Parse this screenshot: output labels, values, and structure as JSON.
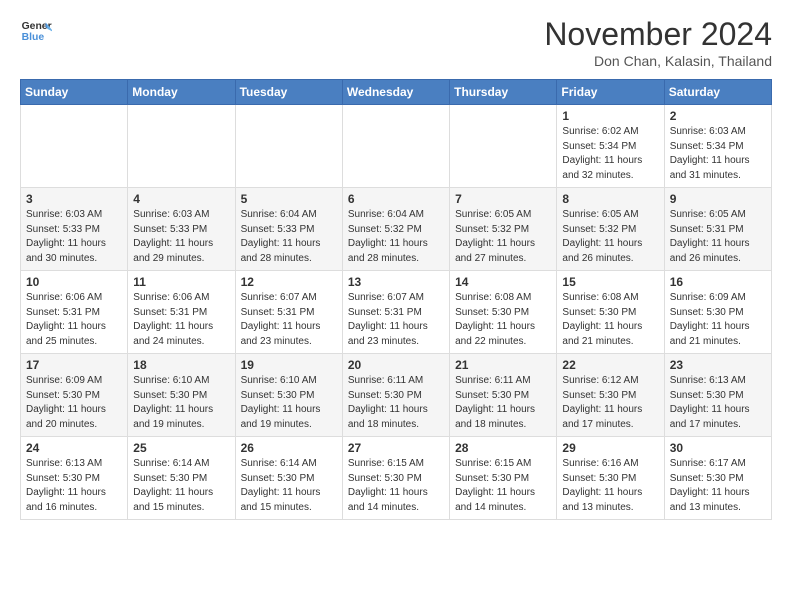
{
  "header": {
    "logo_general": "General",
    "logo_blue": "Blue",
    "month": "November 2024",
    "location": "Don Chan, Kalasin, Thailand"
  },
  "days_of_week": [
    "Sunday",
    "Monday",
    "Tuesday",
    "Wednesday",
    "Thursday",
    "Friday",
    "Saturday"
  ],
  "weeks": [
    {
      "days": [
        {
          "num": "",
          "info": ""
        },
        {
          "num": "",
          "info": ""
        },
        {
          "num": "",
          "info": ""
        },
        {
          "num": "",
          "info": ""
        },
        {
          "num": "",
          "info": ""
        },
        {
          "num": "1",
          "info": "Sunrise: 6:02 AM\nSunset: 5:34 PM\nDaylight: 11 hours\nand 32 minutes."
        },
        {
          "num": "2",
          "info": "Sunrise: 6:03 AM\nSunset: 5:34 PM\nDaylight: 11 hours\nand 31 minutes."
        }
      ]
    },
    {
      "days": [
        {
          "num": "3",
          "info": "Sunrise: 6:03 AM\nSunset: 5:33 PM\nDaylight: 11 hours\nand 30 minutes."
        },
        {
          "num": "4",
          "info": "Sunrise: 6:03 AM\nSunset: 5:33 PM\nDaylight: 11 hours\nand 29 minutes."
        },
        {
          "num": "5",
          "info": "Sunrise: 6:04 AM\nSunset: 5:33 PM\nDaylight: 11 hours\nand 28 minutes."
        },
        {
          "num": "6",
          "info": "Sunrise: 6:04 AM\nSunset: 5:32 PM\nDaylight: 11 hours\nand 28 minutes."
        },
        {
          "num": "7",
          "info": "Sunrise: 6:05 AM\nSunset: 5:32 PM\nDaylight: 11 hours\nand 27 minutes."
        },
        {
          "num": "8",
          "info": "Sunrise: 6:05 AM\nSunset: 5:32 PM\nDaylight: 11 hours\nand 26 minutes."
        },
        {
          "num": "9",
          "info": "Sunrise: 6:05 AM\nSunset: 5:31 PM\nDaylight: 11 hours\nand 26 minutes."
        }
      ]
    },
    {
      "days": [
        {
          "num": "10",
          "info": "Sunrise: 6:06 AM\nSunset: 5:31 PM\nDaylight: 11 hours\nand 25 minutes."
        },
        {
          "num": "11",
          "info": "Sunrise: 6:06 AM\nSunset: 5:31 PM\nDaylight: 11 hours\nand 24 minutes."
        },
        {
          "num": "12",
          "info": "Sunrise: 6:07 AM\nSunset: 5:31 PM\nDaylight: 11 hours\nand 23 minutes."
        },
        {
          "num": "13",
          "info": "Sunrise: 6:07 AM\nSunset: 5:31 PM\nDaylight: 11 hours\nand 23 minutes."
        },
        {
          "num": "14",
          "info": "Sunrise: 6:08 AM\nSunset: 5:30 PM\nDaylight: 11 hours\nand 22 minutes."
        },
        {
          "num": "15",
          "info": "Sunrise: 6:08 AM\nSunset: 5:30 PM\nDaylight: 11 hours\nand 21 minutes."
        },
        {
          "num": "16",
          "info": "Sunrise: 6:09 AM\nSunset: 5:30 PM\nDaylight: 11 hours\nand 21 minutes."
        }
      ]
    },
    {
      "days": [
        {
          "num": "17",
          "info": "Sunrise: 6:09 AM\nSunset: 5:30 PM\nDaylight: 11 hours\nand 20 minutes."
        },
        {
          "num": "18",
          "info": "Sunrise: 6:10 AM\nSunset: 5:30 PM\nDaylight: 11 hours\nand 19 minutes."
        },
        {
          "num": "19",
          "info": "Sunrise: 6:10 AM\nSunset: 5:30 PM\nDaylight: 11 hours\nand 19 minutes."
        },
        {
          "num": "20",
          "info": "Sunrise: 6:11 AM\nSunset: 5:30 PM\nDaylight: 11 hours\nand 18 minutes."
        },
        {
          "num": "21",
          "info": "Sunrise: 6:11 AM\nSunset: 5:30 PM\nDaylight: 11 hours\nand 18 minutes."
        },
        {
          "num": "22",
          "info": "Sunrise: 6:12 AM\nSunset: 5:30 PM\nDaylight: 11 hours\nand 17 minutes."
        },
        {
          "num": "23",
          "info": "Sunrise: 6:13 AM\nSunset: 5:30 PM\nDaylight: 11 hours\nand 17 minutes."
        }
      ]
    },
    {
      "days": [
        {
          "num": "24",
          "info": "Sunrise: 6:13 AM\nSunset: 5:30 PM\nDaylight: 11 hours\nand 16 minutes."
        },
        {
          "num": "25",
          "info": "Sunrise: 6:14 AM\nSunset: 5:30 PM\nDaylight: 11 hours\nand 15 minutes."
        },
        {
          "num": "26",
          "info": "Sunrise: 6:14 AM\nSunset: 5:30 PM\nDaylight: 11 hours\nand 15 minutes."
        },
        {
          "num": "27",
          "info": "Sunrise: 6:15 AM\nSunset: 5:30 PM\nDaylight: 11 hours\nand 14 minutes."
        },
        {
          "num": "28",
          "info": "Sunrise: 6:15 AM\nSunset: 5:30 PM\nDaylight: 11 hours\nand 14 minutes."
        },
        {
          "num": "29",
          "info": "Sunrise: 6:16 AM\nSunset: 5:30 PM\nDaylight: 11 hours\nand 13 minutes."
        },
        {
          "num": "30",
          "info": "Sunrise: 6:17 AM\nSunset: 5:30 PM\nDaylight: 11 hours\nand 13 minutes."
        }
      ]
    }
  ]
}
